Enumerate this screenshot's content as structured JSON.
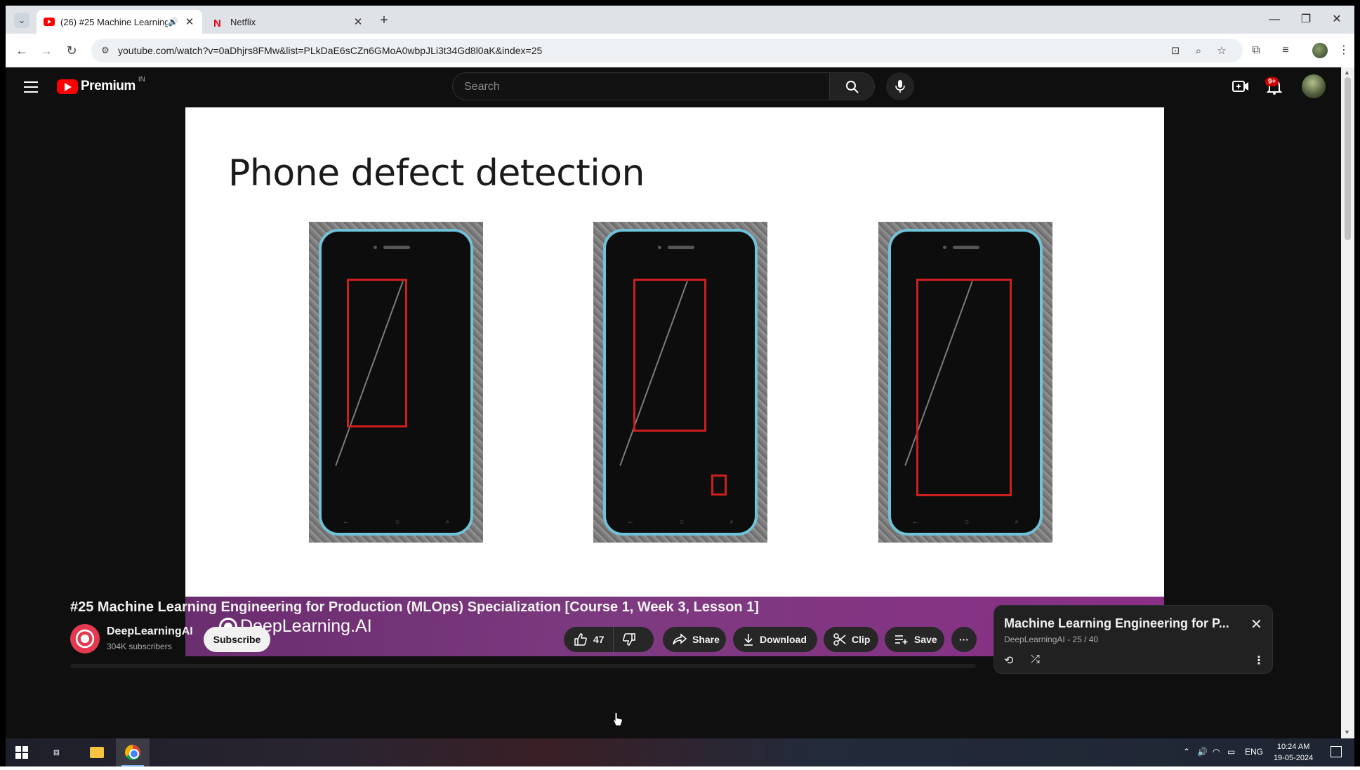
{
  "browser": {
    "tabs": [
      {
        "title": "(26) #25 Machine Learning",
        "audio_icon": "speaker-icon",
        "close": "✕",
        "favicon": "youtube-icon"
      },
      {
        "title": "Netflix",
        "close": "✕",
        "favicon": "netflix-icon",
        "favicon_glyph": "N"
      }
    ],
    "new_tab": "+",
    "window_controls": {
      "minimize": "—",
      "restore": "❐",
      "close": "✕"
    },
    "nav": {
      "back": "←",
      "forward": "→",
      "reload": "↻"
    },
    "url": "youtube.com/watch?v=0aDhjrs8FMw&list=PLkDaE6sCZn6GMoA0wbpJLi3t34Gd8l0aK&index=25"
  },
  "youtube": {
    "logo_text": "Premium",
    "region": "IN",
    "search_placeholder": "Search",
    "notification_count": "9+"
  },
  "video": {
    "slide_title": "Phone defect detection",
    "brand": "DeepLearning.AI",
    "title": "#25 Machine Learning Engineering for Production (MLOps) Specialization [Course 1, Week 3, Lesson 1]"
  },
  "channel": {
    "name": "DeepLearningAI",
    "subscribers": "304K subscribers",
    "subscribe_label": "Subscribe"
  },
  "actions": {
    "likes": "47",
    "share": "Share",
    "download": "Download",
    "clip": "Clip",
    "save": "Save",
    "more": "···"
  },
  "playlist": {
    "title": "Machine Learning Engineering for P...",
    "meta": "DeepLearningAI - 25 / 40",
    "close": "✕",
    "kebab": "⋮"
  },
  "taskbar": {
    "language": "ENG",
    "time": "10:24 AM",
    "date": "19-05-2024"
  },
  "colors": {
    "youtube_red": "#ff0000",
    "defect_red": "#cc1f1f",
    "phone_bezel": "#6fc2d8",
    "brand_purple": "#7d3a80"
  }
}
